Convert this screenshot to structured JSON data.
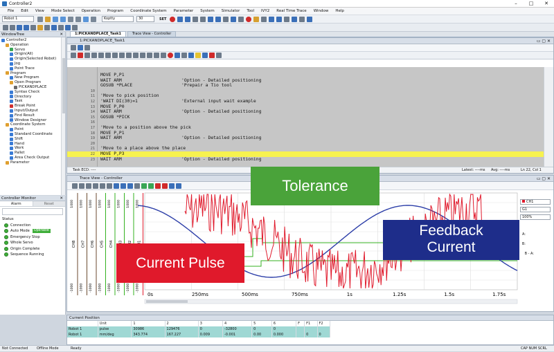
{
  "window": {
    "title": "Controller2"
  },
  "menu": [
    "File",
    "Edit",
    "View",
    "Mode Select",
    "Operation",
    "Program",
    "Coordinate System",
    "Parameter",
    "System",
    "Simulator",
    "Tool",
    "IVY2",
    "Real Time Trace",
    "Window",
    "Help"
  ],
  "toolbar": {
    "robot_select": "Robot 1",
    "speed_select": "Koptty",
    "speed_value": "30",
    "set_label": "SET"
  },
  "tabs": [
    {
      "label": "1:PICKANDPLACE_Task1",
      "active": true
    },
    {
      "label": "Trace View - Controller",
      "active": false
    }
  ],
  "window_tree": {
    "title": "WindowTree",
    "items": [
      {
        "label": "Controller2",
        "level": 0,
        "color": "#3a7bd5"
      },
      {
        "label": "Operation",
        "level": 1,
        "color": "#e0a030"
      },
      {
        "label": "Servo",
        "level": 2,
        "color": "#3aa655"
      },
      {
        "label": "Origin(All)",
        "level": 2,
        "color": "#3a7bd5"
      },
      {
        "label": "Origin(Selected Robot)",
        "level": 2,
        "color": "#3a7bd5"
      },
      {
        "label": "Jog",
        "level": 2,
        "color": "#3a7bd5"
      },
      {
        "label": "Point Trace",
        "level": 2,
        "color": "#3a7bd5"
      },
      {
        "label": "Program",
        "level": 1,
        "color": "#e0a030"
      },
      {
        "label": "New Program",
        "level": 2,
        "color": "#3a7bd5"
      },
      {
        "label": "Open Program",
        "level": 2,
        "color": "#e0a030"
      },
      {
        "label": "PICKANDPLACE",
        "level": 3,
        "color": "#6a6a6a"
      },
      {
        "label": "Syntax Check",
        "level": 2,
        "color": "#3a7bd5"
      },
      {
        "label": "Directory",
        "level": 2,
        "color": "#3a7bd5"
      },
      {
        "label": "Task",
        "level": 2,
        "color": "#3a7bd5"
      },
      {
        "label": "Break Point",
        "level": 2,
        "color": "#d03030"
      },
      {
        "label": "Input/Output",
        "level": 2,
        "color": "#3a7bd5"
      },
      {
        "label": "Find Result",
        "level": 2,
        "color": "#3a7bd5"
      },
      {
        "label": "Window Designer",
        "level": 2,
        "color": "#3a7bd5"
      },
      {
        "label": "Coordinate System",
        "level": 1,
        "color": "#e0a030"
      },
      {
        "label": "Point",
        "level": 2,
        "color": "#3a7bd5"
      },
      {
        "label": "Standard Coordinate",
        "level": 2,
        "color": "#3a7bd5"
      },
      {
        "label": "Shift",
        "level": 2,
        "color": "#3a7bd5"
      },
      {
        "label": "Hand",
        "level": 2,
        "color": "#3a7bd5"
      },
      {
        "label": "Work",
        "level": 2,
        "color": "#3a7bd5"
      },
      {
        "label": "Pallet",
        "level": 2,
        "color": "#3a7bd5"
      },
      {
        "label": "Area Check Output",
        "level": 2,
        "color": "#3a7bd5"
      },
      {
        "label": "Parameter",
        "level": 1,
        "color": "#e0a030"
      }
    ]
  },
  "monitor": {
    "title": "Controller Monitor",
    "tabs": [
      "Alarm",
      "Reset"
    ],
    "status_label": "Status",
    "items": [
      {
        "label": "Connection"
      },
      {
        "label": "Auto Mode",
        "badge": "Operable"
      },
      {
        "label": "Emergency Stop"
      },
      {
        "label": "Whole Servo"
      },
      {
        "label": "Origin Complete"
      },
      {
        "label": "Sequence Running"
      }
    ]
  },
  "editor": {
    "title": "1:PICKANDPLACE_Task1",
    "lines": [
      {
        "n": "",
        "code": "MOVE P,P1",
        "comment": ""
      },
      {
        "n": "",
        "code": "WAIT ARM",
        "comment": "'Option - Detailed positioning"
      },
      {
        "n": "",
        "code": "GOSUB *PLACE",
        "comment": "'Prepair a Tio tool"
      },
      {
        "n": "10",
        "code": "",
        "comment": ""
      },
      {
        "n": "11",
        "code": "'Move to pick position",
        "comment": ""
      },
      {
        "n": "12",
        "code": "'WAIT DI(30)=1",
        "comment": "'External input wait example"
      },
      {
        "n": "13",
        "code": "MOVE P,P0",
        "comment": ""
      },
      {
        "n": "14",
        "code": "WAIT ARM",
        "comment": "'Option - Detailed positioning"
      },
      {
        "n": "15",
        "code": "GOSUB *PICK",
        "comment": ""
      },
      {
        "n": "16",
        "code": "",
        "comment": ""
      },
      {
        "n": "17",
        "code": "'Move to a position above the pick",
        "comment": ""
      },
      {
        "n": "18",
        "code": "MOVE P,P1",
        "comment": ""
      },
      {
        "n": "19",
        "code": "WAIT ARM",
        "comment": "'Option - Detailed positioning"
      },
      {
        "n": "20",
        "code": "",
        "comment": ""
      },
      {
        "n": "21",
        "code": "'Move to a place above the place",
        "comment": ""
      },
      {
        "n": "22",
        "code": "MOVE P,P3",
        "comment": "",
        "highlight": true
      },
      {
        "n": "23",
        "code": "WAIT ARM",
        "comment": "'Option - Detailed positioning"
      }
    ],
    "status": {
      "task": "Task ECD: ----",
      "latest": "Latest: ----ms",
      "avg": "Avg: ----ms",
      "pos": "Ln 22, Col 1"
    }
  },
  "trace": {
    "title": "Trace View - Controller",
    "channels": [
      "CH8",
      "CH7",
      "CH6",
      "CH5",
      "CH4",
      "CH3",
      "CH2",
      "CH1"
    ],
    "axis_top": "1000",
    "axis_bottom": "-1000",
    "time_ticks": [
      "0s",
      "250ms",
      "500ms",
      "750ms",
      "1s",
      "1.25s",
      "1.5s",
      "1.75s"
    ],
    "ch_select": "CH1",
    "g_select": "G1",
    "zoom_select": "100%",
    "cursor_labels": [
      "A:",
      "B:",
      "B - A:"
    ],
    "series_colors": {
      "pulse": "#e0192b",
      "feedback": "#2c3ea8",
      "tolerance": "#33b21f"
    }
  },
  "callouts": {
    "tolerance": {
      "text": "Tolerance",
      "color": "#4aa33a"
    },
    "current_pulse": {
      "text": "Current Pulse",
      "color": "#e0192b"
    },
    "feedback": {
      "text": "Feedback Current",
      "line1": "Feedback",
      "line2": "Current",
      "color": "#1e2d8a"
    }
  },
  "position": {
    "title": "Current Position",
    "headers": [
      "",
      "Unit",
      "1",
      "2",
      "3",
      "4",
      "5",
      "6",
      "F",
      "F1",
      "F2"
    ],
    "rows": [
      [
        "Robot 1",
        "pulse",
        "30986",
        "129476",
        "0",
        "-32800",
        "0",
        "0",
        "",
        "",
        ""
      ],
      [
        "Robot 1",
        "mm/deg",
        "343.774",
        "167.227",
        "0.009",
        "-0.001",
        "0.00",
        "0.000",
        "",
        "0",
        "0"
      ]
    ]
  },
  "statusbar": {
    "left": "Not Connected",
    "mode": "Offline Mode",
    "ready": "Ready",
    "right": "CAP NUM SCRL"
  }
}
